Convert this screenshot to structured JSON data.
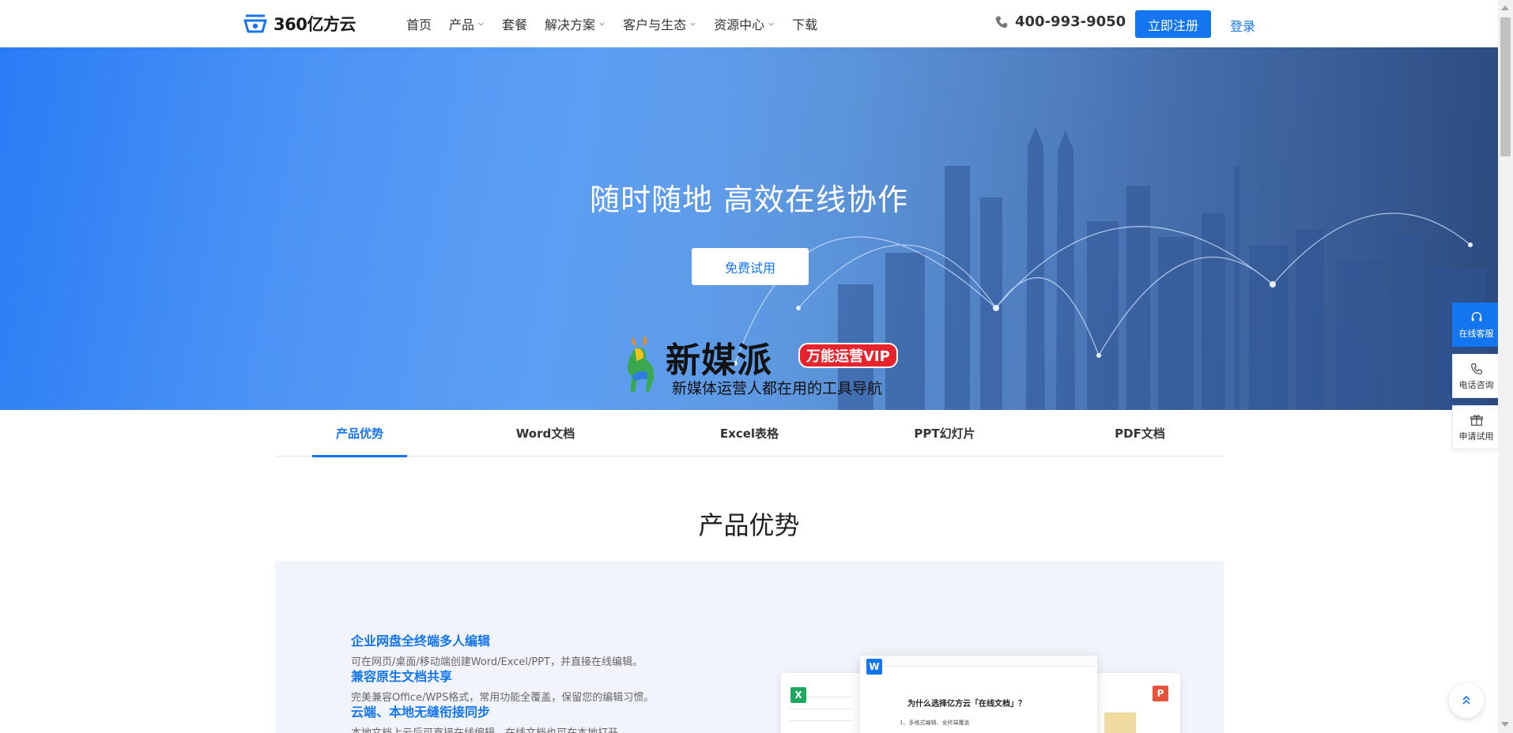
{
  "header": {
    "brand": "360亿方云",
    "nav": [
      {
        "label": "首页",
        "has_menu": false
      },
      {
        "label": "产品",
        "has_menu": true
      },
      {
        "label": "套餐",
        "has_menu": false
      },
      {
        "label": "解决方案",
        "has_menu": true
      },
      {
        "label": "客户与生态",
        "has_menu": true
      },
      {
        "label": "资源中心",
        "has_menu": true
      },
      {
        "label": "下载",
        "has_menu": false
      }
    ],
    "phone": "400-993-9050",
    "register_label": "立即注册",
    "login_label": "登录",
    "accent_color": "#1475f0"
  },
  "hero": {
    "title": "随时随地 高效在线协作",
    "trial_label": "免费试用",
    "ad": {
      "title": "新媒派",
      "badge": "万能运营VIP",
      "subtitle": "新媒体运营人都在用的工具导航"
    }
  },
  "tabs": [
    {
      "label": "产品优势",
      "active": true
    },
    {
      "label": "Word文档",
      "active": false
    },
    {
      "label": "Excel表格",
      "active": false
    },
    {
      "label": "PPT幻灯片",
      "active": false
    },
    {
      "label": "PDF文档",
      "active": false
    }
  ],
  "section": {
    "title": "产品优势",
    "features": [
      {
        "title": "企业网盘全终端多人编辑",
        "desc": "可在网页/桌面/移动端创建Word/Excel/PPT，并直接在线编辑。"
      },
      {
        "title": "兼容原生文档共享",
        "desc": "完美兼容Office/WPS格式，常用功能全覆盖，保留您的编辑习惯。"
      },
      {
        "title": "云端、本地无缝衔接同步",
        "desc": "本地文档上云后可直接在线编辑，在线文档也可在本地打开。"
      }
    ],
    "mockup_doc_title": "为什么选择亿方云「在线文档」？",
    "mockup_line": "1、多格式编辑、全终端覆盖",
    "mockup_badges": [
      "W",
      "X",
      "P"
    ]
  },
  "float_bar": [
    {
      "label": "在线客服",
      "icon": "headset-icon",
      "highlight": true
    },
    {
      "label": "电话咨询",
      "icon": "phone-icon",
      "highlight": false
    },
    {
      "label": "申请试用",
      "icon": "gift-icon",
      "highlight": false
    }
  ]
}
